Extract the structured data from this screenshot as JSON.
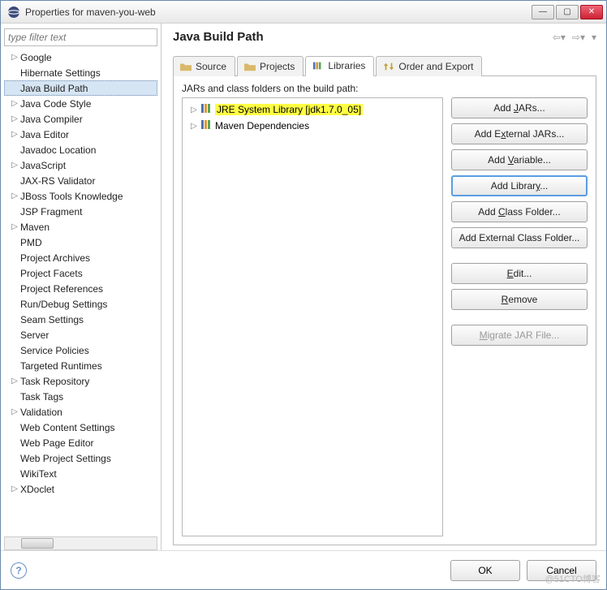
{
  "titlebar": {
    "text": "Properties for maven-you-web"
  },
  "filter": {
    "placeholder": "type filter text"
  },
  "sidebar": {
    "items": [
      {
        "label": "Google",
        "exp": true
      },
      {
        "label": "Hibernate Settings",
        "exp": false
      },
      {
        "label": "Java Build Path",
        "exp": false,
        "selected": true
      },
      {
        "label": "Java Code Style",
        "exp": true
      },
      {
        "label": "Java Compiler",
        "exp": true
      },
      {
        "label": "Java Editor",
        "exp": true
      },
      {
        "label": "Javadoc Location",
        "exp": false
      },
      {
        "label": "JavaScript",
        "exp": true
      },
      {
        "label": "JAX-RS Validator",
        "exp": false
      },
      {
        "label": "JBoss Tools Knowledge",
        "exp": true
      },
      {
        "label": "JSP Fragment",
        "exp": false
      },
      {
        "label": "Maven",
        "exp": true
      },
      {
        "label": "PMD",
        "exp": false
      },
      {
        "label": "Project Archives",
        "exp": false
      },
      {
        "label": "Project Facets",
        "exp": false
      },
      {
        "label": "Project References",
        "exp": false
      },
      {
        "label": "Run/Debug Settings",
        "exp": false
      },
      {
        "label": "Seam Settings",
        "exp": false
      },
      {
        "label": "Server",
        "exp": false
      },
      {
        "label": "Service Policies",
        "exp": false
      },
      {
        "label": "Targeted Runtimes",
        "exp": false
      },
      {
        "label": "Task Repository",
        "exp": true
      },
      {
        "label": "Task Tags",
        "exp": false
      },
      {
        "label": "Validation",
        "exp": true
      },
      {
        "label": "Web Content Settings",
        "exp": false
      },
      {
        "label": "Web Page Editor",
        "exp": false
      },
      {
        "label": "Web Project Settings",
        "exp": false
      },
      {
        "label": "WikiText",
        "exp": false
      },
      {
        "label": "XDoclet",
        "exp": true
      }
    ]
  },
  "page": {
    "title": "Java Build Path",
    "tabs": [
      "Source",
      "Projects",
      "Libraries",
      "Order and Export"
    ],
    "desc": "JARs and class folders on the build path:"
  },
  "libs": [
    {
      "label": "JRE System Library [jdk1.7.0_05]",
      "highlight": true
    },
    {
      "label": "Maven Dependencies",
      "highlight": false
    }
  ],
  "buttons": {
    "add_jars": "Add JARs...",
    "add_ext_jars": "Add External JARs...",
    "add_var": "Add Variable...",
    "add_lib": "Add Library...",
    "add_cf": "Add Class Folder...",
    "add_ext_cf": "Add External Class Folder...",
    "edit": "Edit...",
    "remove": "Remove",
    "migrate": "Migrate JAR File..."
  },
  "footer": {
    "ok": "OK",
    "cancel": "Cancel"
  },
  "watermark": "@51CTO博客"
}
